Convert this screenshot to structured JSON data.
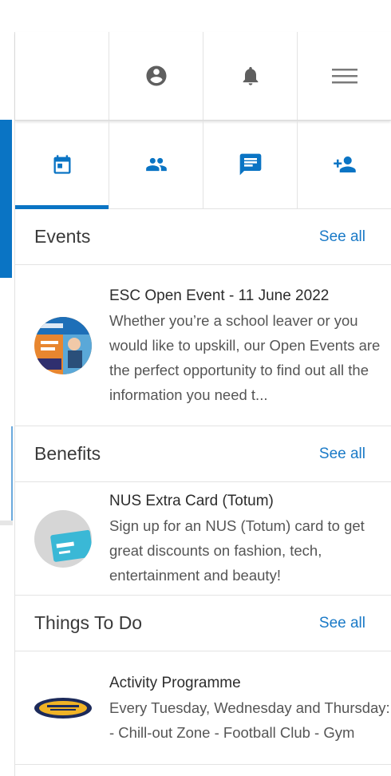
{
  "header": {
    "icons": [
      "blank",
      "account-icon",
      "bell-icon",
      "menu-icon"
    ]
  },
  "tabs": [
    {
      "icon": "calendar-icon",
      "active": true
    },
    {
      "icon": "group-icon",
      "active": false
    },
    {
      "icon": "chat-icon",
      "active": false
    },
    {
      "icon": "add-person-icon",
      "active": false
    }
  ],
  "colors": {
    "accent": "#0a74c4",
    "link": "#1a7ac7",
    "border": "#e3e3e3"
  },
  "sections": {
    "events": {
      "title": "Events",
      "see_all": "See all",
      "item": {
        "title": "ESC Open Event - 11 June 2022",
        "description": "Whether you’re a school leaver or you would like to upskill, our Open Events are the perfect opportunity to find out all the information you need t..."
      }
    },
    "benefits": {
      "title": "Benefits",
      "see_all": "See all",
      "item": {
        "title": "NUS Extra Card (Totum)",
        "description": "Sign up for an NUS (Totum) card to get great discounts on fashion, tech, entertainment and beauty!"
      }
    },
    "things": {
      "title": "Things To Do",
      "see_all": "See all",
      "item": {
        "title": "Activity Programme",
        "description": "Every Tuesday, Wednesday and Thursday: - Chill-out Zone - Football Club - Gym"
      }
    }
  }
}
